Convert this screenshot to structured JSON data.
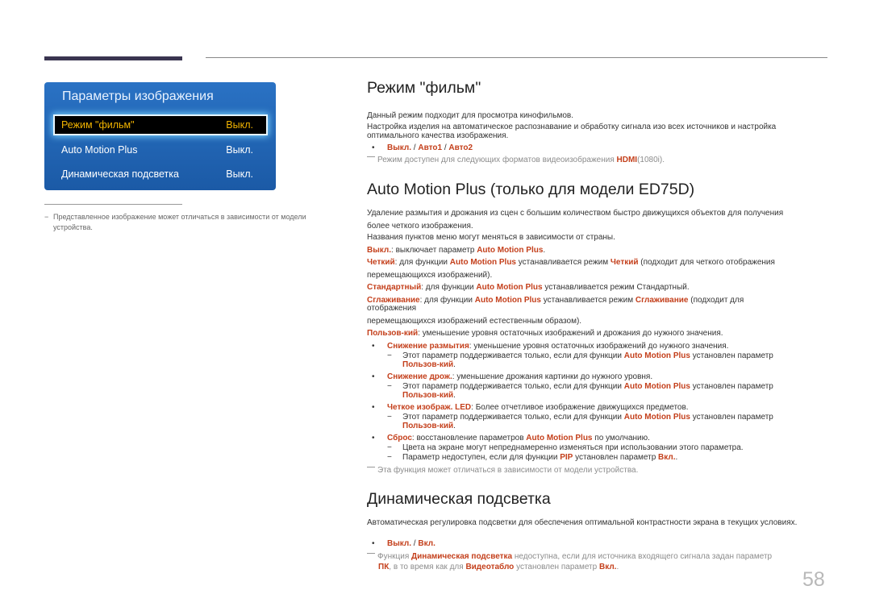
{
  "osd": {
    "title": "Параметры изображения",
    "rows": [
      {
        "label": "Режим \"фильм\"",
        "value": "Выкл.",
        "selected": true
      },
      {
        "label": "Auto Motion Plus",
        "value": "Выкл.",
        "selected": false
      },
      {
        "label": "Динамическая подсветка",
        "value": "Выкл.",
        "selected": false
      }
    ],
    "colors": {
      "panel": "#1f63b3",
      "selected_text": "#f2b400",
      "selected_bg": "#000000"
    }
  },
  "left_note": {
    "dash": "−",
    "text": "Представленное изображение может отличаться в зависимости от модели устройства."
  },
  "accent_color": "#c4401c",
  "film_mode": {
    "heading": "Режим \"фильм\"",
    "p1": "Данный режим подходит для просмотра кинофильмов.",
    "p2": "Настройка изделия на автоматическое распознавание и обработку сигнала изо всех источников и настройка оптимального качества изображения.",
    "options": [
      "Выкл.",
      "Авто1",
      "Авто2"
    ],
    "sep": " / ",
    "note_pre": "Режим доступен для следующих форматов видеоизображения ",
    "note_hl": "HDMI",
    "note_post": "(1080i)."
  },
  "amp": {
    "heading": "Auto Motion Plus (только для модели ED75D)",
    "p1": "Удаление размытия и дрожания из сцен с большим количеством быстро движущихся объектов для получения более четкого изображения.",
    "p2": "Названия пунктов меню могут меняться в зависимости от страны.",
    "name": "Auto Motion Plus",
    "off": {
      "term": "Выкл.",
      "text": ": выключает параметр ",
      "end": "."
    },
    "clear": {
      "term": "Четкий",
      "t1": ": для функции ",
      "t2": " устанавливается режим ",
      "t3": " (подходит для четкого отображения",
      "t4": "перемещающихся изображений)."
    },
    "standard": {
      "term": "Стандартный",
      "t1": ": для функции ",
      "t2": " устанавливается режим Стандартный."
    },
    "smooth": {
      "term": "Сглаживание",
      "t1": ": для функции ",
      "t2": " устанавливается режим ",
      "t3": " (подходит для",
      "t4": "отображения",
      "t5": "перемещающихся изображений естественным образом)."
    },
    "custom": {
      "term": "Пользов-кий",
      "text": ": уменьшение уровня остаточных изображений и дрожания до нужного значения."
    },
    "bullets": [
      {
        "term": "Снижение размытия",
        "text": ": уменьшение уровня остаточных изображений до нужного значения."
      },
      {
        "term": "Снижение дрож.",
        "text": ": уменьшение дрожания картинки до нужного уровня."
      },
      {
        "term": "Четкое изображ. LED",
        "text": ": Более отчетливое изображение движущихся предметов."
      },
      {
        "term": "Сброс",
        "text": ": восстановление параметров ",
        "text2": " по умолчанию."
      }
    ],
    "sub_note": {
      "t1": "Этот параметр поддерживается только, если для функции ",
      "t2": " установлен параметр",
      "term": "Пользов-кий",
      "end": "."
    },
    "reset_notes": {
      "n1": "Цвета на экране могут непреднамеренно изменяться при использовании этого параметра.",
      "n2_pre": "Параметр недоступен, если для функции ",
      "n2_pip": "PIP",
      "n2_mid": " установлен параметр ",
      "n2_on": "Вкл.",
      "n2_end": "."
    },
    "dash": "−",
    "footnote": "Эта функция может отличаться в зависимости от модели устройства."
  },
  "dyn": {
    "heading": "Динамическая подсветка",
    "p1": "Автоматическая регулировка подсветки для обеспечения оптимальной контрастности экрана в текущих условиях.",
    "options": [
      "Выкл.",
      "Вкл."
    ],
    "sep": " / ",
    "note": {
      "t1": "Функция ",
      "hl1": "Динамическая подсветка",
      "t2": " недоступна, если для источника входящего сигнала задан параметр",
      "hl2": "ПК",
      "t3": ", в то время как для ",
      "hl3": "Видеотабло",
      "t4": " установлен параметр ",
      "hl4": "Вкл.",
      "t5": "."
    }
  },
  "bullet_glyph": "•",
  "page_number": "58"
}
